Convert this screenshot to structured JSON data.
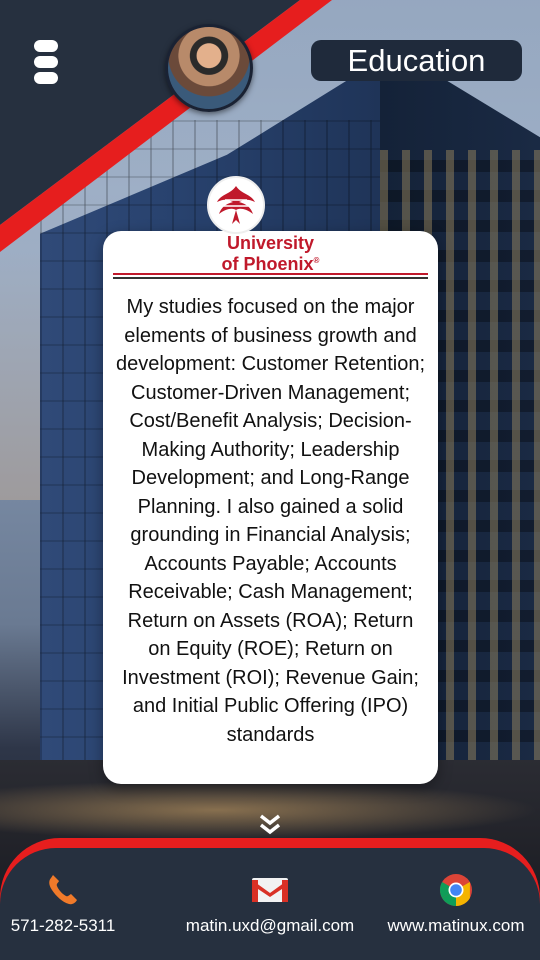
{
  "header": {
    "section_title": "Education"
  },
  "institution": {
    "name_line1": "University",
    "name_line2": "of Phoenix",
    "trademark": "®"
  },
  "description": "My studies focused on the major elements of business growth and development: Customer Retention; Customer-Driven Management; Cost/Benefit Analysis; Decision-Making Authority; Leadership Development; and Long-Range Planning. I also gained a solid grounding in Financial Analysis; Accounts Payable; Accounts Receivable; Cash Management; Return on Assets (ROA); Return on Equity (ROE); Return on Investment (ROI); Revenue Gain; and Initial Public Offering (IPO) standards",
  "footer": {
    "phone": "571-282-5311",
    "email": "matin.uxd@gmail.com",
    "website": "www.matinux.com"
  },
  "icons": {
    "menu": "menu-icon",
    "scroll": "double-chevron-down-icon",
    "phone": "phone-icon",
    "email": "gmail-icon",
    "web": "chrome-icon"
  },
  "colors": {
    "accent_red": "#e61e1e",
    "dark_panel": "#26303f",
    "brand_red": "#c0192b"
  }
}
